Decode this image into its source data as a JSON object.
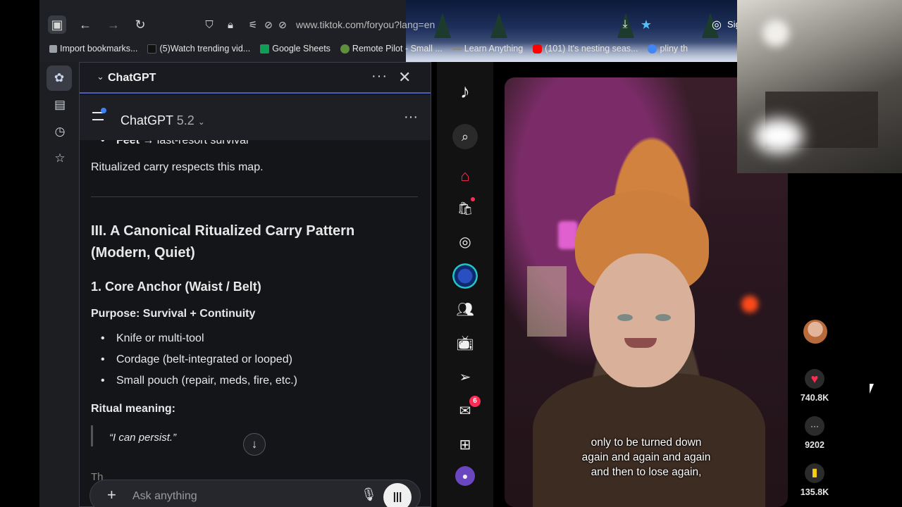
{
  "browser": {
    "url": "www.tiktok.com/foryou?lang=en",
    "bookmarks": [
      {
        "label": "Import bookmarks...",
        "color": "#9aa0a6"
      },
      {
        "label": "(5)Watch trending vid...",
        "color": "#111111"
      },
      {
        "label": "Google Sheets",
        "color": "#0f9d58"
      },
      {
        "label": "Remote Pilot - Small ...",
        "color": "#5e8e3e"
      },
      {
        "label": "Learn Anything",
        "color": "#888888"
      },
      {
        "label": "(101) It's nesting seas...",
        "color": "#ff0000"
      },
      {
        "label": "pliny th",
        "color": "#4285f4"
      }
    ],
    "signin_partial": "Sig"
  },
  "side_panel": {
    "title": "ChatGPT",
    "model_name": "ChatGPT",
    "model_version": "5.2"
  },
  "chat": {
    "bullet_feet_bold": "Feet",
    "bullet_feet_rest": " → last-resort survival",
    "para1": "Ritualized carry respects this map.",
    "heading_line1": "III. A Canonical Ritualized Carry Pattern",
    "heading_line2": "(Modern, Quiet)",
    "subheading": "1. Core Anchor (Waist / Belt)",
    "purpose": "Purpose: Survival + Continuity",
    "items": [
      "Knife or multi-tool",
      "Cordage (belt-integrated or looped)",
      "Small pouch (repair, meds, fire, etc.)"
    ],
    "ritual_label": "Ritual meaning:",
    "quote": "“I can persist.”",
    "partial_line": "Th"
  },
  "composer": {
    "placeholder": "Ask anything"
  },
  "tiktok": {
    "inbox_badge": "6",
    "caption_lines": [
      "only to be turned down",
      "again and again and again",
      "and then to lose again,"
    ],
    "likes": "740.8K",
    "comments": "9202",
    "saves": "135.8K",
    "accent": "#fe2c55",
    "save_color": "#facc15"
  }
}
